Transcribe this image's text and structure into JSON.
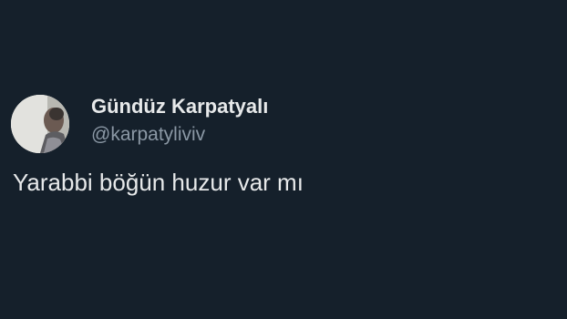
{
  "tweet": {
    "author": {
      "display_name": "Gündüz Karpatyalı",
      "handle": "@karpatyliviv",
      "avatar": "profile-photo"
    },
    "text": "Yarabbi böğün huzur var mı"
  },
  "colors": {
    "background": "#15202b",
    "primary_text": "#e7e9ea",
    "secondary_text": "#8b98a5"
  }
}
